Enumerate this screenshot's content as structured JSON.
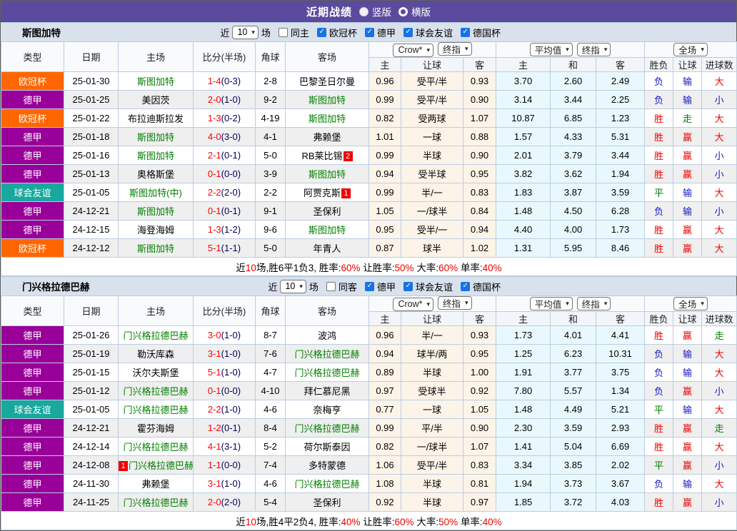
{
  "title_bar": {
    "title": "近期战绩",
    "vertical": "竖版",
    "horizontal": "横版"
  },
  "colors": {
    "header_purple": "#5a4b9e",
    "result": {
      "r": "#ef0000",
      "b": "#1616c8",
      "g": "#007c00"
    },
    "team_green": "#008000",
    "score_red": "#ff0000",
    "half_navy": "#000066",
    "leagues": {
      "欧冠杯": "#ff6600",
      "德甲": "#990099",
      "球会友谊": "#18a89e"
    }
  },
  "table_header": {
    "left": [
      "类型",
      "日期",
      "主场",
      "比分(半场)",
      "角球",
      "客场"
    ],
    "odds_groups": [
      [
        "Crow*",
        "终指"
      ],
      [
        "平均值",
        "终指"
      ],
      [
        "全场"
      ]
    ],
    "right": [
      "主",
      "让球",
      "客",
      "主",
      "和",
      "客",
      "胜负",
      "让球",
      "进球数"
    ]
  },
  "sections": [
    {
      "team": "斯图加特",
      "filter": {
        "near": "近",
        "count": "10",
        "games": "场",
        "same": "同主",
        "same_checked": false,
        "leagues": [
          "欧冠杯",
          "德甲",
          "球会友谊",
          "德国杯"
        ]
      },
      "rows": [
        {
          "lg": "欧冠杯",
          "d": "25-01-30",
          "h": "斯图加特",
          "hg": true,
          "hb": "",
          "s": "1-4",
          "hs": "(0-3)",
          "c": "2-8",
          "a": "巴黎圣日尔曼",
          "ag": false,
          "ab": "",
          "o1": "0.96",
          "hc": "受平/半",
          "o2": "0.93",
          "m1": "3.70",
          "m2": "2.60",
          "m3": "2.49",
          "r1": [
            "负",
            "b"
          ],
          "r2": [
            "输",
            "b"
          ],
          "r3": [
            "大",
            "r"
          ]
        },
        {
          "lg": "德甲",
          "d": "25-01-25",
          "h": "美因茨",
          "hg": false,
          "hb": "",
          "s": "2-0",
          "hs": "(1-0)",
          "c": "9-2",
          "a": "斯图加特",
          "ag": true,
          "ab": "",
          "o1": "0.99",
          "hc": "受平/半",
          "o2": "0.90",
          "m1": "3.14",
          "m2": "3.44",
          "m3": "2.25",
          "r1": [
            "负",
            "b"
          ],
          "r2": [
            "输",
            "b"
          ],
          "r3": [
            "小",
            "b"
          ]
        },
        {
          "lg": "欧冠杯",
          "d": "25-01-22",
          "h": "布拉迪斯拉发",
          "hg": false,
          "hb": "",
          "s": "1-3",
          "hs": "(0-2)",
          "c": "4-19",
          "a": "斯图加特",
          "ag": true,
          "ab": "",
          "o1": "0.82",
          "hc": "受两球",
          "o2": "1.07",
          "m1": "10.87",
          "m2": "6.85",
          "m3": "1.23",
          "r1": [
            "胜",
            "r"
          ],
          "r2": [
            "走",
            "g"
          ],
          "r3": [
            "大",
            "r"
          ]
        },
        {
          "lg": "德甲",
          "d": "25-01-18",
          "h": "斯图加特",
          "hg": true,
          "hb": "",
          "s": "4-0",
          "hs": "(3-0)",
          "c": "4-1",
          "a": "弗赖堡",
          "ag": false,
          "ab": "",
          "o1": "1.01",
          "hc": "一球",
          "o2": "0.88",
          "m1": "1.57",
          "m2": "4.33",
          "m3": "5.31",
          "r1": [
            "胜",
            "r"
          ],
          "r2": [
            "赢",
            "r"
          ],
          "r3": [
            "大",
            "r"
          ]
        },
        {
          "lg": "德甲",
          "d": "25-01-16",
          "h": "斯图加特",
          "hg": true,
          "hb": "",
          "s": "2-1",
          "hs": "(0-1)",
          "c": "5-0",
          "a": "RB莱比锡",
          "ag": false,
          "ab": "2",
          "o1": "0.99",
          "hc": "半球",
          "o2": "0.90",
          "m1": "2.01",
          "m2": "3.79",
          "m3": "3.44",
          "r1": [
            "胜",
            "r"
          ],
          "r2": [
            "赢",
            "r"
          ],
          "r3": [
            "小",
            "b"
          ]
        },
        {
          "lg": "德甲",
          "d": "25-01-13",
          "h": "奥格斯堡",
          "hg": false,
          "hb": "",
          "s": "0-1",
          "hs": "(0-0)",
          "c": "3-9",
          "a": "斯图加特",
          "ag": true,
          "ab": "",
          "o1": "0.94",
          "hc": "受半球",
          "o2": "0.95",
          "m1": "3.82",
          "m2": "3.62",
          "m3": "1.94",
          "r1": [
            "胜",
            "r"
          ],
          "r2": [
            "赢",
            "r"
          ],
          "r3": [
            "小",
            "b"
          ]
        },
        {
          "lg": "球会友谊",
          "d": "25-01-05",
          "h": "斯图加特(中)",
          "hg": true,
          "hb": "",
          "s": "2-2",
          "hs": "(2-0)",
          "c": "2-2",
          "a": "阿贾克斯",
          "ag": false,
          "ab": "1",
          "o1": "0.99",
          "hc": "半/一",
          "o2": "0.83",
          "m1": "1.83",
          "m2": "3.87",
          "m3": "3.59",
          "r1": [
            "平",
            "g"
          ],
          "r2": [
            "输",
            "b"
          ],
          "r3": [
            "大",
            "r"
          ]
        },
        {
          "lg": "德甲",
          "d": "24-12-21",
          "h": "斯图加特",
          "hg": true,
          "hb": "",
          "s": "0-1",
          "hs": "(0-1)",
          "c": "9-1",
          "a": "圣保利",
          "ag": false,
          "ab": "",
          "o1": "1.05",
          "hc": "一/球半",
          "o2": "0.84",
          "m1": "1.48",
          "m2": "4.50",
          "m3": "6.28",
          "r1": [
            "负",
            "b"
          ],
          "r2": [
            "输",
            "b"
          ],
          "r3": [
            "小",
            "b"
          ]
        },
        {
          "lg": "德甲",
          "d": "24-12-15",
          "h": "海登海姆",
          "hg": false,
          "hb": "",
          "s": "1-3",
          "hs": "(1-2)",
          "c": "9-6",
          "a": "斯图加特",
          "ag": true,
          "ab": "",
          "o1": "0.95",
          "hc": "受半/一",
          "o2": "0.94",
          "m1": "4.40",
          "m2": "4.00",
          "m3": "1.73",
          "r1": [
            "胜",
            "r"
          ],
          "r2": [
            "赢",
            "r"
          ],
          "r3": [
            "大",
            "r"
          ]
        },
        {
          "lg": "欧冠杯",
          "d": "24-12-12",
          "h": "斯图加特",
          "hg": true,
          "hb": "",
          "s": "5-1",
          "hs": "(1-1)",
          "c": "5-0",
          "a": "年青人",
          "ag": false,
          "ab": "",
          "o1": "0.87",
          "hc": "球半",
          "o2": "1.02",
          "m1": "1.31",
          "m2": "5.95",
          "m3": "8.46",
          "r1": [
            "胜",
            "r"
          ],
          "r2": [
            "赢",
            "r"
          ],
          "r3": [
            "大",
            "r"
          ]
        }
      ],
      "summary": [
        [
          "近",
          0
        ],
        [
          "10",
          1
        ],
        [
          "场,胜6平1负3, 胜率:",
          0
        ],
        [
          "60%",
          1
        ],
        [
          " 让胜率:",
          0
        ],
        [
          "50%",
          1
        ],
        [
          " 大率:",
          0
        ],
        [
          "60%",
          1
        ],
        [
          " 单率:",
          0
        ],
        [
          "40%",
          1
        ]
      ]
    },
    {
      "team": "门兴格拉德巴赫",
      "filter": {
        "near": "近",
        "count": "10",
        "games": "场",
        "same": "同客",
        "same_checked": false,
        "leagues": [
          "德甲",
          "球会友谊",
          "德国杯"
        ]
      },
      "rows": [
        {
          "lg": "德甲",
          "d": "25-01-26",
          "h": "门兴格拉德巴赫",
          "hg": true,
          "hb": "",
          "s": "3-0",
          "hs": "(1-0)",
          "c": "8-7",
          "a": "波鸿",
          "ag": false,
          "ab": "",
          "o1": "0.96",
          "hc": "半/一",
          "o2": "0.93",
          "m1": "1.73",
          "m2": "4.01",
          "m3": "4.41",
          "r1": [
            "胜",
            "r"
          ],
          "r2": [
            "赢",
            "r"
          ],
          "r3": [
            "走",
            "g"
          ]
        },
        {
          "lg": "德甲",
          "d": "25-01-19",
          "h": "勒沃库森",
          "hg": false,
          "hb": "",
          "s": "3-1",
          "hs": "(1-0)",
          "c": "7-6",
          "a": "门兴格拉德巴赫",
          "ag": true,
          "ab": "",
          "o1": "0.94",
          "hc": "球半/两",
          "o2": "0.95",
          "m1": "1.25",
          "m2": "6.23",
          "m3": "10.31",
          "r1": [
            "负",
            "b"
          ],
          "r2": [
            "输",
            "b"
          ],
          "r3": [
            "大",
            "r"
          ]
        },
        {
          "lg": "德甲",
          "d": "25-01-15",
          "h": "沃尔夫斯堡",
          "hg": false,
          "hb": "",
          "s": "5-1",
          "hs": "(1-0)",
          "c": "4-7",
          "a": "门兴格拉德巴赫",
          "ag": true,
          "ab": "",
          "o1": "0.89",
          "hc": "半球",
          "o2": "1.00",
          "m1": "1.91",
          "m2": "3.77",
          "m3": "3.75",
          "r1": [
            "负",
            "b"
          ],
          "r2": [
            "输",
            "b"
          ],
          "r3": [
            "大",
            "r"
          ]
        },
        {
          "lg": "德甲",
          "d": "25-01-12",
          "h": "门兴格拉德巴赫",
          "hg": true,
          "hb": "",
          "s": "0-1",
          "hs": "(0-0)",
          "c": "4-10",
          "a": "拜仁慕尼黑",
          "ag": false,
          "ab": "",
          "o1": "0.97",
          "hc": "受球半",
          "o2": "0.92",
          "m1": "7.80",
          "m2": "5.57",
          "m3": "1.34",
          "r1": [
            "负",
            "b"
          ],
          "r2": [
            "赢",
            "r"
          ],
          "r3": [
            "小",
            "b"
          ]
        },
        {
          "lg": "球会友谊",
          "d": "25-01-05",
          "h": "门兴格拉德巴赫",
          "hg": true,
          "hb": "",
          "s": "2-2",
          "hs": "(1-0)",
          "c": "4-6",
          "a": "奈梅亨",
          "ag": false,
          "ab": "",
          "o1": "0.77",
          "hc": "一球",
          "o2": "1.05",
          "m1": "1.48",
          "m2": "4.49",
          "m3": "5.21",
          "r1": [
            "平",
            "g"
          ],
          "r2": [
            "输",
            "b"
          ],
          "r3": [
            "大",
            "r"
          ]
        },
        {
          "lg": "德甲",
          "d": "24-12-21",
          "h": "霍芬海姆",
          "hg": false,
          "hb": "",
          "s": "1-2",
          "hs": "(0-1)",
          "c": "8-4",
          "a": "门兴格拉德巴赫",
          "ag": true,
          "ab": "",
          "o1": "0.99",
          "hc": "平/半",
          "o2": "0.90",
          "m1": "2.30",
          "m2": "3.59",
          "m3": "2.93",
          "r1": [
            "胜",
            "r"
          ],
          "r2": [
            "赢",
            "r"
          ],
          "r3": [
            "走",
            "g"
          ]
        },
        {
          "lg": "德甲",
          "d": "24-12-14",
          "h": "门兴格拉德巴赫",
          "hg": true,
          "hb": "",
          "s": "4-1",
          "hs": "(3-1)",
          "c": "5-2",
          "a": "荷尔斯泰因",
          "ag": false,
          "ab": "",
          "o1": "0.82",
          "hc": "一/球半",
          "o2": "1.07",
          "m1": "1.41",
          "m2": "5.04",
          "m3": "6.69",
          "r1": [
            "胜",
            "r"
          ],
          "r2": [
            "赢",
            "r"
          ],
          "r3": [
            "大",
            "r"
          ]
        },
        {
          "lg": "德甲",
          "d": "24-12-08",
          "h": "门兴格拉德巴赫",
          "hg": true,
          "hb": "1",
          "s": "1-1",
          "hs": "(0-0)",
          "c": "7-4",
          "a": "多特蒙德",
          "ag": false,
          "ab": "",
          "o1": "1.06",
          "hc": "受平/半",
          "o2": "0.83",
          "m1": "3.34",
          "m2": "3.85",
          "m3": "2.02",
          "r1": [
            "平",
            "g"
          ],
          "r2": [
            "赢",
            "r"
          ],
          "r3": [
            "小",
            "b"
          ]
        },
        {
          "lg": "德甲",
          "d": "24-11-30",
          "h": "弗赖堡",
          "hg": false,
          "hb": "",
          "s": "3-1",
          "hs": "(1-0)",
          "c": "4-6",
          "a": "门兴格拉德巴赫",
          "ag": true,
          "ab": "",
          "o1": "1.08",
          "hc": "半球",
          "o2": "0.81",
          "m1": "1.94",
          "m2": "3.73",
          "m3": "3.67",
          "r1": [
            "负",
            "b"
          ],
          "r2": [
            "输",
            "b"
          ],
          "r3": [
            "大",
            "r"
          ]
        },
        {
          "lg": "德甲",
          "d": "24-11-25",
          "h": "门兴格拉德巴赫",
          "hg": true,
          "hb": "",
          "s": "2-0",
          "hs": "(2-0)",
          "c": "5-4",
          "a": "圣保利",
          "ag": false,
          "ab": "",
          "o1": "0.92",
          "hc": "半球",
          "o2": "0.97",
          "m1": "1.85",
          "m2": "3.72",
          "m3": "4.03",
          "r1": [
            "胜",
            "r"
          ],
          "r2": [
            "赢",
            "r"
          ],
          "r3": [
            "小",
            "b"
          ]
        }
      ],
      "summary": [
        [
          "近",
          0
        ],
        [
          "10",
          1
        ],
        [
          "场,胜4平2负4, 胜率:",
          0
        ],
        [
          "40%",
          1
        ],
        [
          " 让胜率:",
          0
        ],
        [
          "60%",
          1
        ],
        [
          " 大率:",
          0
        ],
        [
          "50%",
          1
        ],
        [
          " 单率:",
          0
        ],
        [
          "40%",
          1
        ]
      ]
    }
  ]
}
